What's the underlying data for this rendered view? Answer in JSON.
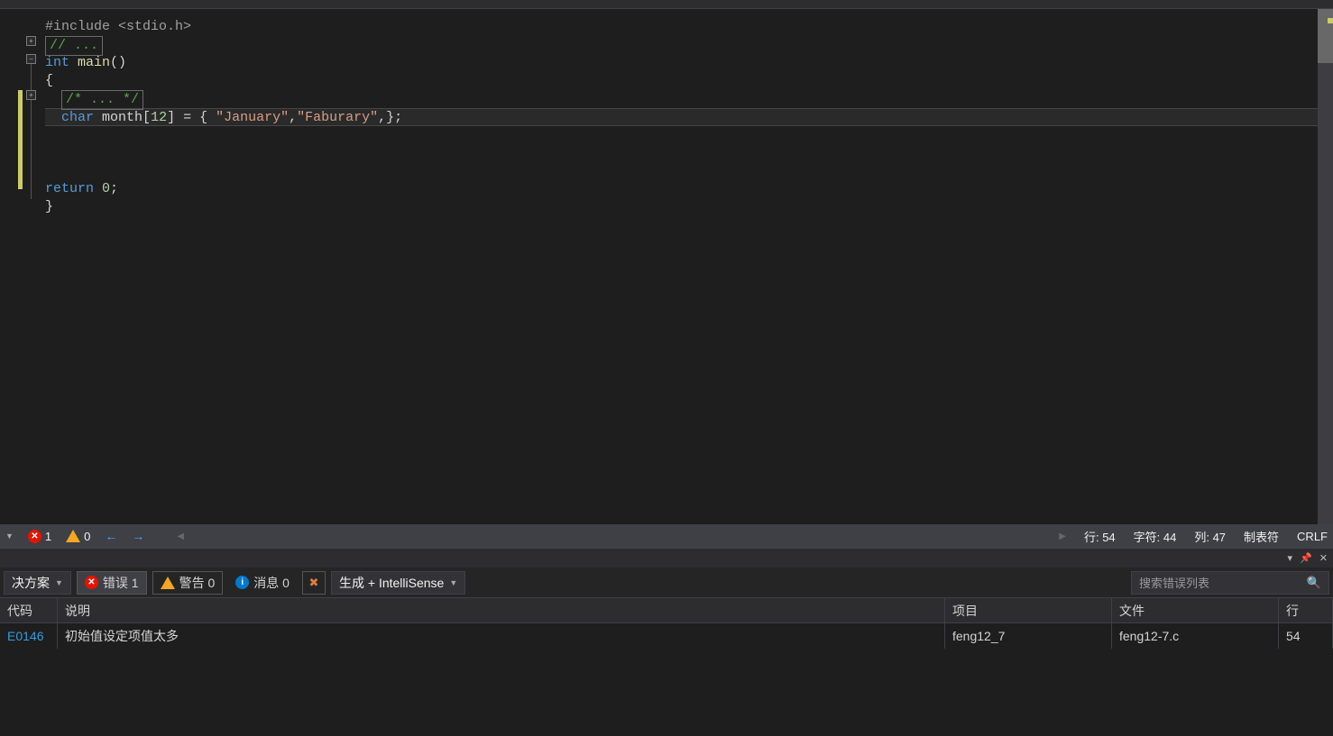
{
  "editor": {
    "code_lines": [
      {
        "indent": 0,
        "content_html": "<span class='inc'>#include &lt;stdio.h&gt;</span>"
      },
      {
        "indent": 0,
        "boxed": true,
        "content_html": "<span class='comment'>// ...</span>"
      },
      {
        "indent": 0,
        "content_html": "<span class='kw'>int</span> <span class='fn'>main</span>()"
      },
      {
        "indent": 0,
        "content_html": "{"
      },
      {
        "indent": 2,
        "boxed": true,
        "content_html": "<span class='comment'>/* ... */</span>"
      },
      {
        "indent": 2,
        "highlighted": true,
        "content_html": "<span class='kw'>char</span> <span class='plain'>month[</span><span class='num'>12</span><span class='plain'>] = { </span><span class='str'>\"January\"</span><span class='plain'>,</span><span class='str'>\"Faburary\"</span><span class='plain'>,};</span>"
      },
      {
        "indent": 0,
        "content_html": ""
      },
      {
        "indent": 0,
        "content_html": ""
      },
      {
        "indent": 0,
        "content_html": ""
      },
      {
        "indent": 0,
        "content_html": "<span class='kw'>return</span> <span class='num'>0</span>;"
      },
      {
        "indent": 0,
        "content_html": "}"
      }
    ]
  },
  "footer": {
    "errors_count": "1",
    "warnings_count": "0",
    "line_label": "行: 54",
    "char_label": "字符: 44",
    "col_label": "列: 47",
    "indent_label": "制表符",
    "lineend_label": "CRLF"
  },
  "errlist": {
    "scope_dd": "决方案",
    "errors_label": "错误 1",
    "warnings_label": "警告 0",
    "messages_label": "消息 0",
    "build_dd": "生成 + IntelliSense",
    "search_placeholder": "搜索错误列表",
    "columns": {
      "code": "代码",
      "desc": "说明",
      "proj": "项目",
      "file": "文件",
      "line": "行"
    },
    "rows": [
      {
        "code": "E0146",
        "desc": "初始值设定项值太多",
        "proj": "feng12_7",
        "file": "feng12-7.c",
        "line": "54"
      }
    ]
  }
}
